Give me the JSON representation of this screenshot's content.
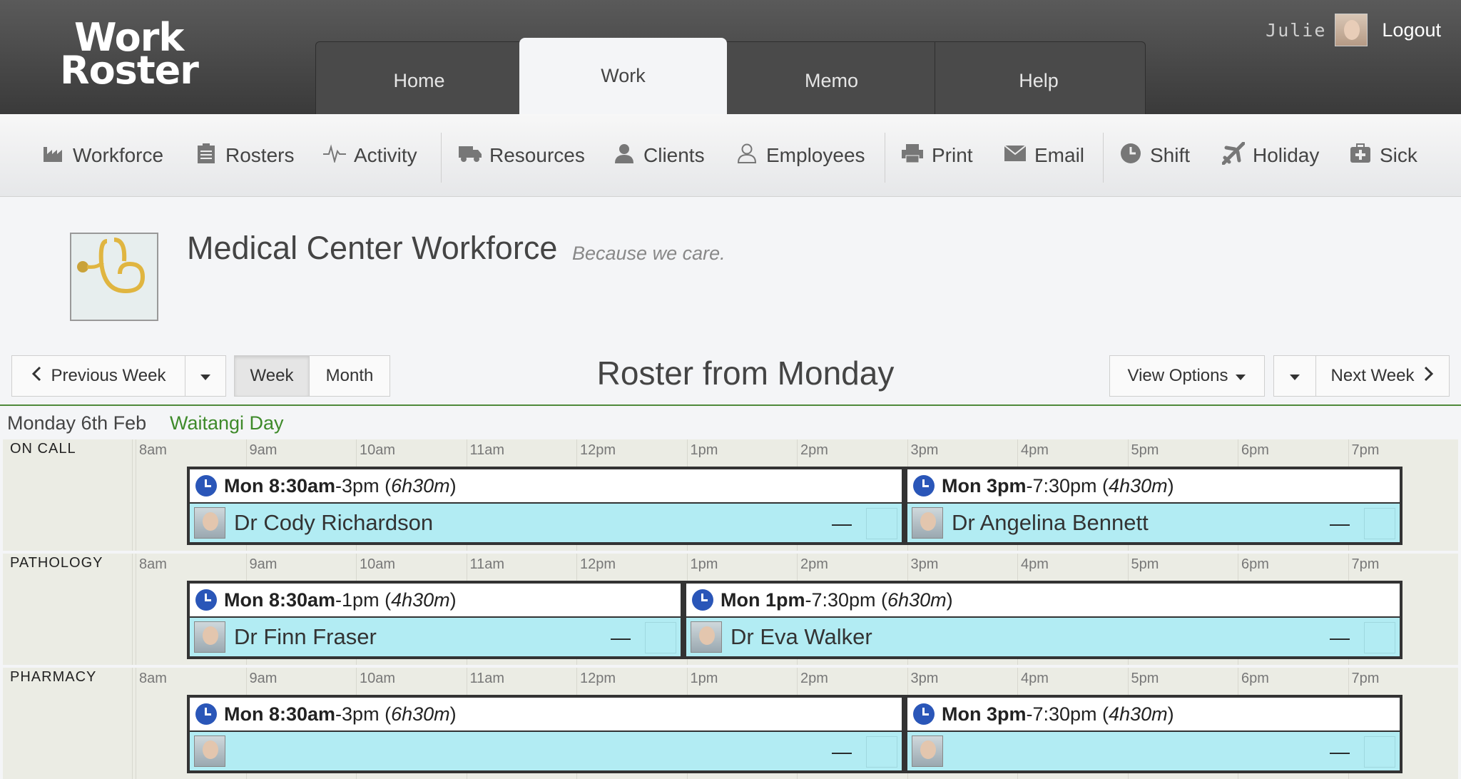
{
  "app": {
    "logo_line1": "Work",
    "logo_line2": "Roster",
    "tabs": [
      "Home",
      "Work",
      "Memo",
      "Help"
    ],
    "active_tab": "Work",
    "user": {
      "name": "Julie",
      "logout": "Logout"
    }
  },
  "toolbar": {
    "items": [
      {
        "label": "Workforce",
        "icon": "factory-icon"
      },
      {
        "label": "Rosters",
        "icon": "clipboard-icon"
      },
      {
        "label": "Activity",
        "icon": "pulse-icon"
      },
      {
        "label": "Resources",
        "icon": "truck-icon"
      },
      {
        "label": "Clients",
        "icon": "user-tie-icon"
      },
      {
        "label": "Employees",
        "icon": "user-icon"
      },
      {
        "label": "Print",
        "icon": "printer-icon"
      },
      {
        "label": "Email",
        "icon": "envelope-icon"
      },
      {
        "label": "Shift",
        "icon": "clock-icon"
      },
      {
        "label": "Holiday",
        "icon": "plane-icon"
      },
      {
        "label": "Sick",
        "icon": "medkit-icon"
      }
    ]
  },
  "company": {
    "title": "Medical Center Workforce",
    "tagline": "Because we care."
  },
  "nav": {
    "previous_week": "Previous Week",
    "week": "Week",
    "month": "Month",
    "title": "Roster from Monday",
    "view_options": "View Options",
    "next_week": "Next Week"
  },
  "day": {
    "date": "Monday 6th Feb",
    "holiday": "Waitangi Day"
  },
  "hours": [
    "8am",
    "9am",
    "10am",
    "11am",
    "12pm",
    "1pm",
    "2pm",
    "3pm",
    "4pm",
    "5pm",
    "6pm",
    "7pm"
  ],
  "rows": [
    {
      "label": "ON CALL",
      "shifts": [
        {
          "start": "Mon 8:30am",
          "end": "-3pm (",
          "dur": "6h30m",
          "close": ")",
          "person": "Dr Cody Richardson"
        },
        {
          "start": "Mon 3pm",
          "end": "-7:30pm (",
          "dur": "4h30m",
          "close": ")",
          "person": "Dr Angelina Bennett"
        }
      ]
    },
    {
      "label": "PATHOLOGY",
      "shifts": [
        {
          "start": "Mon 8:30am",
          "end": "-1pm (",
          "dur": "4h30m",
          "close": ")",
          "person": "Dr Finn Fraser"
        },
        {
          "start": "Mon 1pm",
          "end": "-7:30pm (",
          "dur": "6h30m",
          "close": ")",
          "person": "Dr Eva Walker"
        }
      ]
    },
    {
      "label": "PHARMACY",
      "shifts": [
        {
          "start": "Mon 8:30am",
          "end": "-3pm (",
          "dur": "6h30m",
          "close": ")",
          "person": ""
        },
        {
          "start": "Mon 3pm",
          "end": "-7:30pm (",
          "dur": "4h30m",
          "close": ")",
          "person": ""
        }
      ]
    }
  ]
}
